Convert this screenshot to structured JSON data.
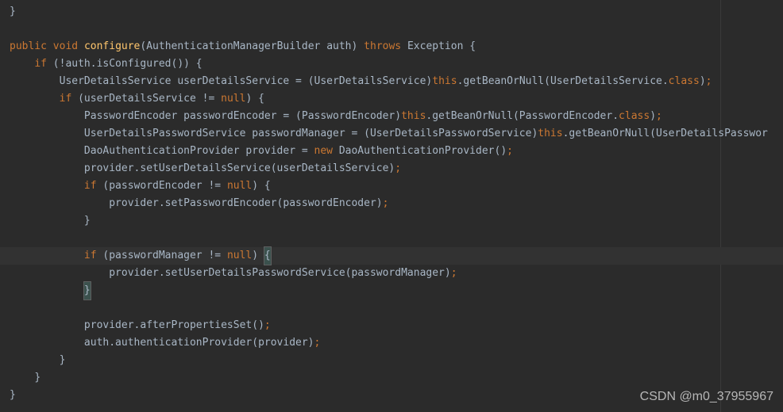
{
  "editor": {
    "top_fragment": "}",
    "signature": {
      "modifiers": [
        "public",
        "void"
      ],
      "method_name": "configure",
      "params_open": "(",
      "param_type": "AuthenticationManagerBuilder",
      "param_name": "auth",
      "params_close": ")",
      "throws_kw": "throws",
      "throws_type": "Exception",
      "body_open": " {"
    },
    "l2": {
      "if_kw": "if",
      "cond": " (!auth.isConfigured()) {"
    },
    "l3": {
      "type": "UserDetailsService",
      "var": " userDetailsService = (UserDetailsService)",
      "this_kw": "this",
      "call": ".getBeanOrNull(UserDetailsService.",
      "class_kw": "class",
      "end": ")",
      "semi": ";"
    },
    "l4": {
      "if_kw": "if",
      "cond_pre": " (userDetailsService != ",
      "null_kw": "null",
      "cond_post": ") {"
    },
    "l5": {
      "type": "PasswordEncoder",
      "var": " passwordEncoder = (PasswordEncoder)",
      "this_kw": "this",
      "call": ".getBeanOrNull(PasswordEncoder.",
      "class_kw": "class",
      "end": ")",
      "semi": ";"
    },
    "l6": {
      "type": "UserDetailsPasswordService",
      "var": " passwordManager = (UserDetailsPasswordService)",
      "this_kw": "this",
      "call": ".getBeanOrNull(UserDetailsPasswor"
    },
    "l7": {
      "type": "DaoAuthenticationProvider",
      "var": " provider = ",
      "new_kw": "new",
      "ctor": " DaoAuthenticationProvider()",
      "semi": ";"
    },
    "l8": {
      "stmt": "provider.setUserDetailsService(userDetailsService)",
      "semi": ";"
    },
    "l9": {
      "if_kw": "if",
      "cond_pre": " (passwordEncoder != ",
      "null_kw": "null",
      "cond_post": ") {"
    },
    "l10": {
      "stmt": "provider.setPasswordEncoder(passwordEncoder)",
      "semi": ";"
    },
    "l11": {
      "brace": "}"
    },
    "l13": {
      "if_kw": "if",
      "cond_pre": " (passwordManager != ",
      "null_kw": "null",
      "cond_post_paren": ") ",
      "open_brace": "{"
    },
    "l14": {
      "stmt": "provider.setUserDetailsPasswordService(passwordManager)",
      "semi": ";"
    },
    "l15": {
      "brace": "}"
    },
    "l17": {
      "stmt": "provider.afterPropertiesSet()",
      "semi": ";"
    },
    "l18": {
      "stmt": "auth.authenticationProvider(provider)",
      "semi": ";"
    },
    "l19": {
      "brace": "}"
    },
    "l20": {
      "brace": "}"
    },
    "l21": {
      "brace": "}"
    }
  },
  "watermark": "CSDN @m0_37955967",
  "colors": {
    "background": "#2b2b2b",
    "text": "#a9b7c6",
    "keyword": "#cc7832",
    "method_name": "#ffc66d",
    "highlight_line": "#323232"
  }
}
